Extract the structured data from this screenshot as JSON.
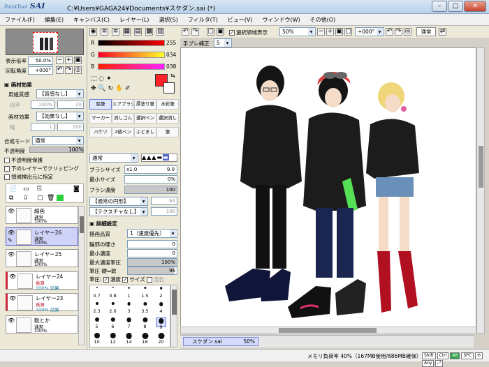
{
  "app": {
    "logo_small": "PaintTool",
    "logo": "SAI",
    "window_title": "C:¥Users¥GAGA24¥Documents¥スケダン.sai (*)",
    "btn_min": "–",
    "btn_max": "□",
    "btn_close": "✕"
  },
  "menu": [
    "ファイル(F)",
    "編集(E)",
    "キャンバス(C)",
    "レイヤー(L)",
    "選択(S)",
    "フィルタ(T)",
    "ビュー(V)",
    "ウィンドウ(W)",
    "その他(O)"
  ],
  "nav": {
    "zoom_label": "表示倍率",
    "zoom_value": "50.0%",
    "angle_label": "回転角度",
    "angle_value": "+000°"
  },
  "paper": {
    "section": "画材効果",
    "texture_label": "用紙質感",
    "texture_value": "【質感なし】",
    "texture_scale_label": "倍率",
    "texture_scale": "100%",
    "texture_strength": "20",
    "effect_label": "画材効果",
    "effect_value": "【効果なし】",
    "effect_width_label": "幅",
    "effect_width": "1",
    "effect_strength": "100"
  },
  "layerprops": {
    "blend_label": "合成モード",
    "blend_value": "通常",
    "opacity_label": "不透明度",
    "opacity_value": "100%",
    "preserve": "不透明度保護",
    "clip": "下のレイヤーでクリッピング",
    "select_src": "領域検出元に指定"
  },
  "layers": [
    {
      "name": "線画",
      "mode": "通常",
      "opacity": "100%"
    },
    {
      "name": "レイヤー26",
      "mode": "通常",
      "opacity": "100%"
    },
    {
      "name": "レイヤー25",
      "mode": "通常",
      "opacity": "100%"
    },
    {
      "name": "レイヤー24",
      "mode": "乗算",
      "opacity": "100% 効果"
    },
    {
      "name": "レイヤー23",
      "mode": "乗算",
      "opacity": "100% 効果"
    },
    {
      "name": "靴とか",
      "mode": "通常",
      "opacity": "100%"
    }
  ],
  "color": {
    "r_label": "R",
    "g_label": "G",
    "b_label": "B",
    "r": "255",
    "g": "034",
    "b": "038",
    "accent": "#ff2226"
  },
  "tools": [
    "鉛筆",
    "エアブラシ",
    "厚塗り筆",
    "水彩筆",
    "マーカー",
    "消しゴム",
    "選択ペン",
    "選択消し",
    "バケツ",
    "2値ペン",
    "ぶどまし",
    "筆"
  ],
  "brush": {
    "mode": "通常",
    "size_label": "ブラシサイズ",
    "size_mult": "x1.0",
    "size_value": "9.0",
    "min_label": "最小サイズ",
    "min_value": "0%",
    "density_label": "ブラシ濃度",
    "density_value": "100",
    "shape": "【通常の円形】",
    "shape_val": "64",
    "texture": "【テクスチャなし】",
    "texture_val": "100",
    "detail_section": "詳細設定",
    "quality_label": "描画品質",
    "quality_value": "1（速度優先）",
    "edge_label": "輪郭の硬さ",
    "edge_value": "0",
    "mindens_label": "最小濃度",
    "mindens_value": "0",
    "maxpress_label": "最大濃度筆圧",
    "maxpress_value": "100%",
    "pressure_label": "筆圧",
    "pressure_hardsoft": "硬⇔軟",
    "pressure_value": "96",
    "pressure2_label": "筆圧:",
    "press_density": "濃度",
    "press_size": "サイズ",
    "press_blend": "混色"
  },
  "sizes": [
    "0.7",
    "0.8",
    "1",
    "1.5",
    "2",
    "2.3",
    "2.6",
    "3",
    "3.5",
    "4",
    "5",
    "6",
    "7",
    "8",
    "9",
    "10",
    "12",
    "14",
    "16",
    "20"
  ],
  "topbar": {
    "stab_label": "手ブレ補正",
    "stab_value": "5",
    "show_sel": "選択領域表示",
    "zoom": "50%",
    "angle": "+000°",
    "mode": "通常"
  },
  "doc": {
    "tab": "スケダン.sai",
    "tab_zoom": "50%"
  },
  "status": {
    "memory": "メモリ負荷率 40%（167MB使用/886MB確保）",
    "keys": [
      "Shift",
      "Ctrl",
      "Alt",
      "SPC",
      "✣",
      "Any",
      "⤢"
    ]
  }
}
